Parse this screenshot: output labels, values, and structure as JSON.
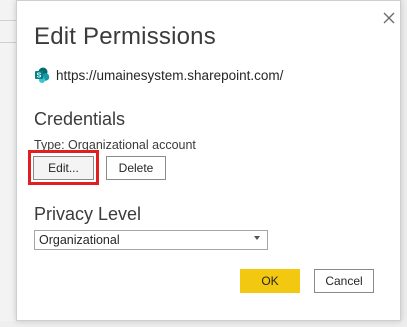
{
  "dialog": {
    "title": "Edit Permissions",
    "site": {
      "icon": "sharepoint-icon",
      "url": "https://umainesystem.sharepoint.com/"
    },
    "credentials": {
      "heading": "Credentials",
      "type_label": "Type: Organizational account",
      "edit_label": "Edit...",
      "delete_label": "Delete"
    },
    "privacy": {
      "heading": "Privacy Level",
      "selected": "Organizational"
    },
    "footer": {
      "ok_label": "OK",
      "cancel_label": "Cancel"
    }
  },
  "colors": {
    "primary_button": "#f2c811",
    "highlight_box": "#e02020",
    "sharepoint_brand": "#038387"
  }
}
